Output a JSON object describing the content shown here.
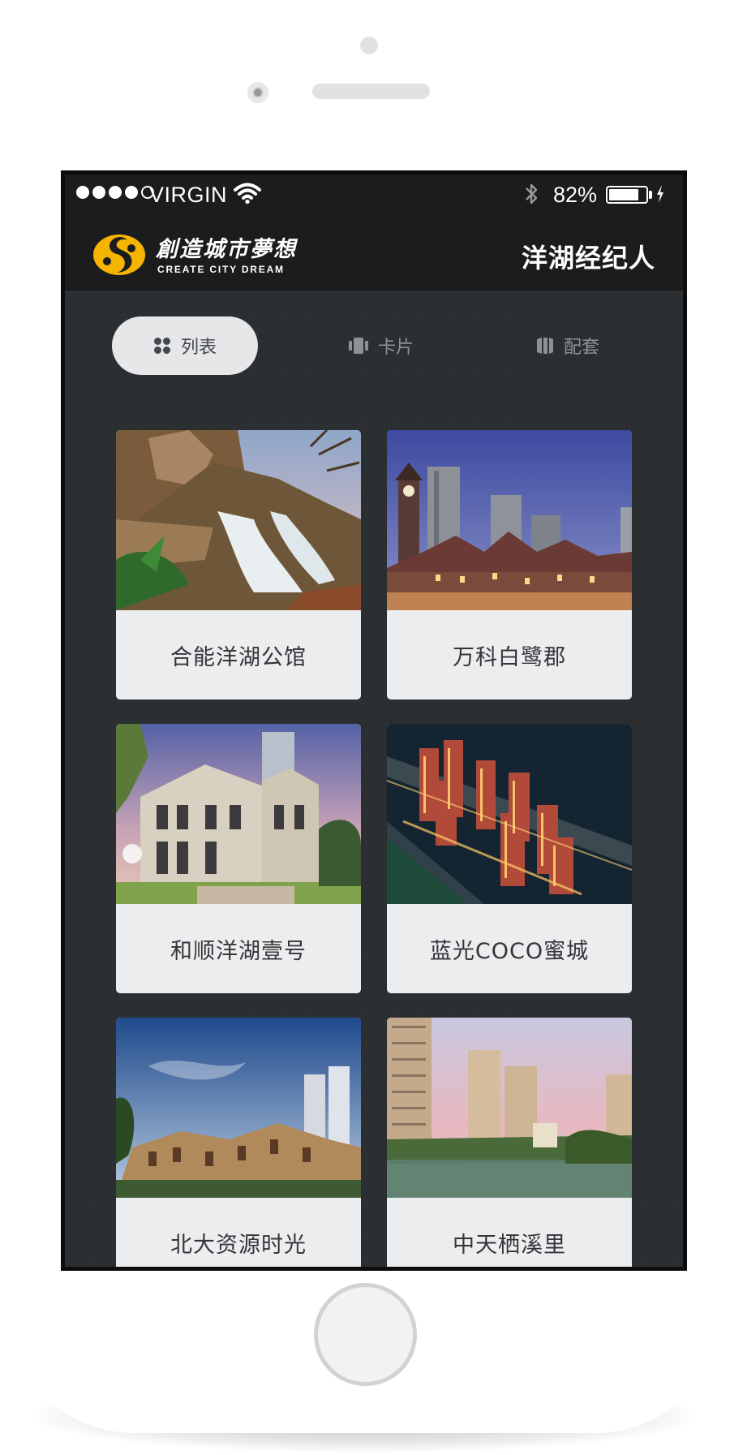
{
  "status_bar": {
    "carrier": "VIRGIN",
    "battery_percent": "82%",
    "battery_level": 0.82,
    "signal_bars_filled": 4,
    "signal_bars_total": 5
  },
  "header": {
    "logo_cn": "創造城市夢想",
    "logo_en": "CREATE CITY DREAM",
    "title": "洋湖经纪人"
  },
  "tabs": [
    {
      "label": "列表",
      "icon": "grid-icon",
      "active": true
    },
    {
      "label": "卡片",
      "icon": "cards-icon",
      "active": false
    },
    {
      "label": "配套",
      "icon": "columns-icon",
      "active": false
    }
  ],
  "projects": [
    {
      "name": "合能洋湖公馆",
      "image": "waterfall-rock-garden-photo"
    },
    {
      "name": "万科白鹭郡",
      "image": "clock-tower-townhouses-photo"
    },
    {
      "name": "和顺洋湖壹号",
      "image": "villa-exterior-photo"
    },
    {
      "name": "蓝光COCO蜜城",
      "image": "night-aerial-towers-photo"
    },
    {
      "name": "北大资源时光",
      "image": "townhouses-blue-sky-photo"
    },
    {
      "name": "中天栖溪里",
      "image": "lakeside-towers-photo"
    }
  ],
  "colors": {
    "screen_bg": "#2a2d30",
    "header_bg": "#1b1c1e",
    "card_bg": "#ecedef",
    "tab_active_bg": "#e6e7e9",
    "logo_yellow": "#f5b400"
  }
}
